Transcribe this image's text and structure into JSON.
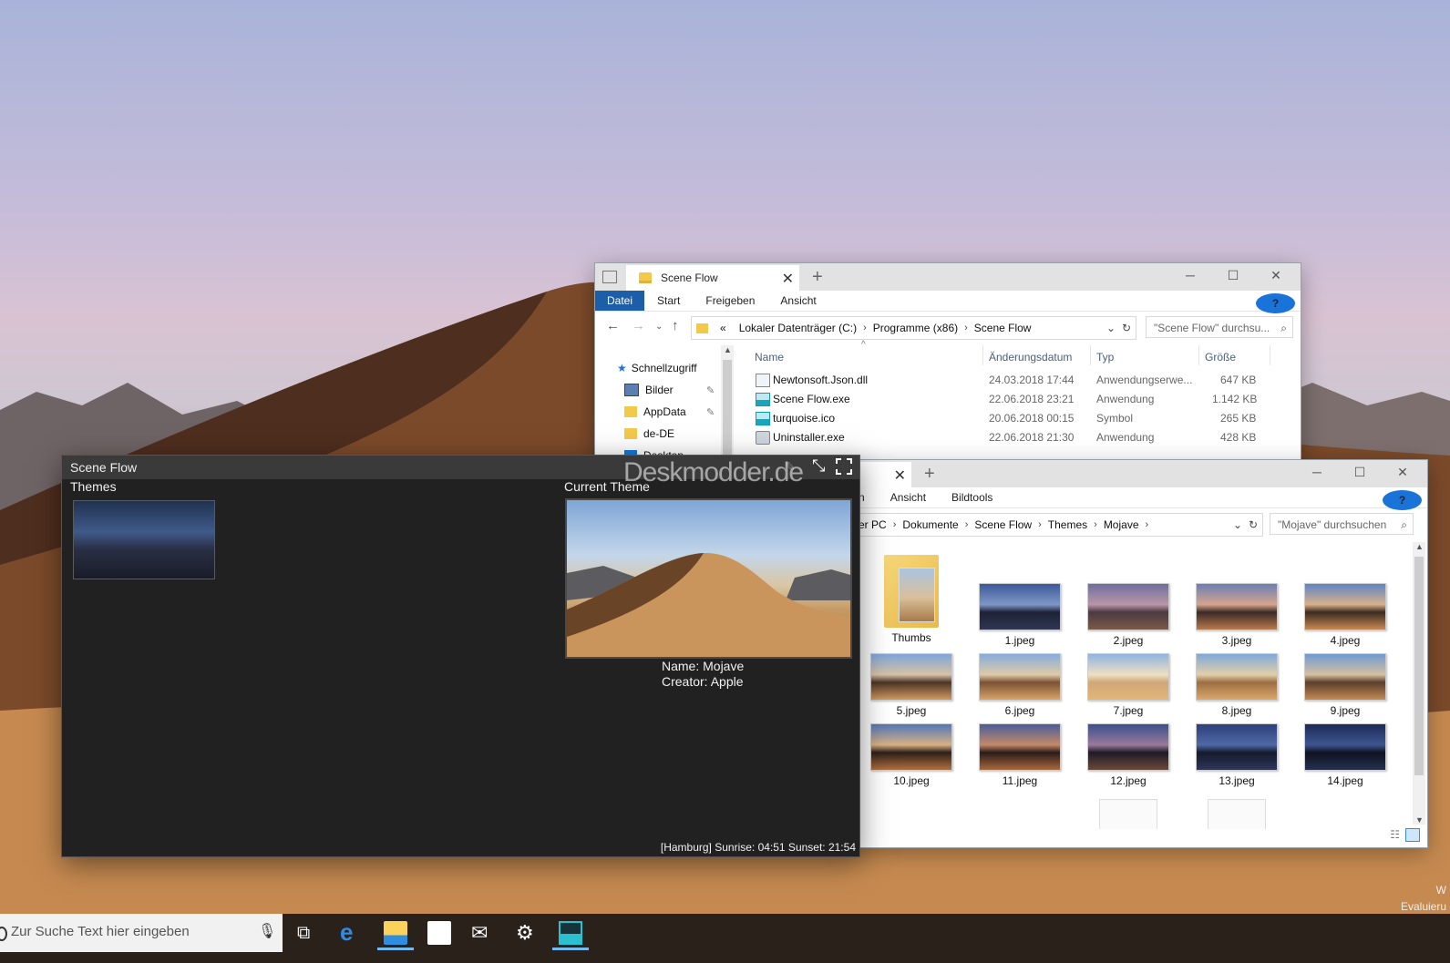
{
  "explorer1": {
    "tab_title": "Scene Flow",
    "ribbon": [
      "Datei",
      "Start",
      "Freigeben",
      "Ansicht"
    ],
    "address": {
      "overflow": "«",
      "parts": [
        "Lokaler Datenträger (C:)",
        "Programme (x86)",
        "Scene Flow"
      ]
    },
    "search_placeholder": "\"Scene Flow\" durchsu...",
    "columns": {
      "name": "Name",
      "date": "Änderungsdatum",
      "type": "Typ",
      "size": "Größe"
    },
    "sidebar": [
      {
        "label": "Schnellzugriff"
      },
      {
        "label": "Bilder"
      },
      {
        "label": "AppData"
      },
      {
        "label": "de-DE"
      },
      {
        "label": "Desktop"
      }
    ],
    "files": [
      {
        "name": "Newtonsoft.Json.dll",
        "date": "24.03.2018 17:44",
        "type": "Anwendungserwe...",
        "size": "647 KB"
      },
      {
        "name": "Scene Flow.exe",
        "date": "22.06.2018 23:21",
        "type": "Anwendung",
        "size": "1.142 KB"
      },
      {
        "name": "turquoise.ico",
        "date": "20.06.2018 00:15",
        "type": "Symbol",
        "size": "265 KB"
      },
      {
        "name": "Uninstaller.exe",
        "date": "22.06.2018 21:30",
        "type": "Anwendung",
        "size": "428 KB"
      }
    ]
  },
  "explorer2": {
    "ribbon": [
      "n",
      "Ansicht",
      "Bildtools"
    ],
    "address": {
      "parts": [
        "er PC",
        "Dokumente",
        "Scene Flow",
        "Themes",
        "Mojave"
      ]
    },
    "search_placeholder": "\"Mojave\" durchsuchen",
    "items": [
      "Thumbs",
      "1.jpeg",
      "2.jpeg",
      "3.jpeg",
      "4.jpeg",
      "5.jpeg",
      "6.jpeg",
      "7.jpeg",
      "8.jpeg",
      "9.jpeg",
      "10.jpeg",
      "11.jpeg",
      "12.jpeg",
      "13.jpeg",
      "14.jpeg"
    ]
  },
  "sceneflow": {
    "title": "Scene Flow",
    "themes_label": "Themes",
    "current_label": "Current Theme",
    "name_line": "Name: Mojave",
    "creator_line": "Creator: Apple",
    "status": "[Hamburg] Sunrise: 04:51 Sunset: 21:54",
    "watermark": "Deskmodder.de"
  },
  "taskbar": {
    "search_placeholder": "Zur Suche Text hier eingeben",
    "icons": [
      "task-view-icon",
      "edge-icon",
      "file-explorer-icon",
      "store-icon",
      "mail-icon",
      "settings-icon",
      "scene-flow-icon"
    ]
  },
  "watermark_text": {
    "line1": "W",
    "line2": "Evaluieru"
  }
}
